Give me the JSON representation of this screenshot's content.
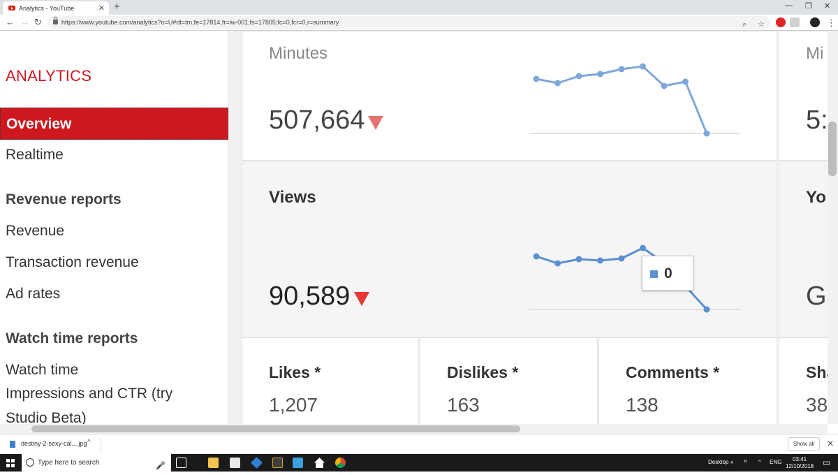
{
  "browser": {
    "tab_title": "Analytics - YouTube",
    "new_tab": "+",
    "url": "https://www.youtube.com/analytics?o=U#dt=tm,fe=17814,fr=lw-001,fs=17805;fc=0,fcr=0,r=summary"
  },
  "sidebar": {
    "brand": "ANALYTICS",
    "items": [
      {
        "label": "Overview",
        "active": true
      },
      {
        "label": "Realtime"
      }
    ],
    "revenue_heading": "Revenue reports",
    "revenue_items": [
      "Revenue",
      "Transaction revenue",
      "Ad rates"
    ],
    "watch_heading": "Watch time reports",
    "watch_items": [
      "Watch time",
      "Impressions and CTR (try",
      "Studio Beta)"
    ]
  },
  "main": {
    "minutes": {
      "title": "Minutes",
      "value": "507,664",
      "trend": "down"
    },
    "right_col_top": {
      "title": "Mi",
      "value": "5:"
    },
    "views": {
      "title": "Views",
      "value": "90,589",
      "trend": "down",
      "tooltip_value": "0"
    },
    "right_col_mid": {
      "title": "Yo",
      "value": "Gl"
    },
    "stats": [
      {
        "title": "Likes *",
        "value": "1,207"
      },
      {
        "title": "Dislikes *",
        "value": "163"
      },
      {
        "title": "Comments *",
        "value": "138"
      },
      {
        "title": "Sha",
        "value": "38"
      }
    ]
  },
  "colors": {
    "brand_red": "#cc181e",
    "sparkline": "#5b8fd0",
    "arrow": "#e57373"
  },
  "sparklines": {
    "minutes": [
      0.78,
      0.72,
      0.82,
      0.85,
      0.92,
      0.96,
      0.68,
      0.74,
      0.0
    ],
    "views": [
      0.76,
      0.66,
      0.72,
      0.7,
      0.73,
      0.88,
      0.67,
      null,
      0.0
    ]
  },
  "downloads": {
    "file": "destiny-2-sexy-cal....jpg",
    "show_all": "Show all"
  },
  "taskbar": {
    "search_placeholder": "Type here to search",
    "desktop_label": "Desktop",
    "lang": "ENG",
    "time": "03:41",
    "date": "12/10/2018"
  }
}
